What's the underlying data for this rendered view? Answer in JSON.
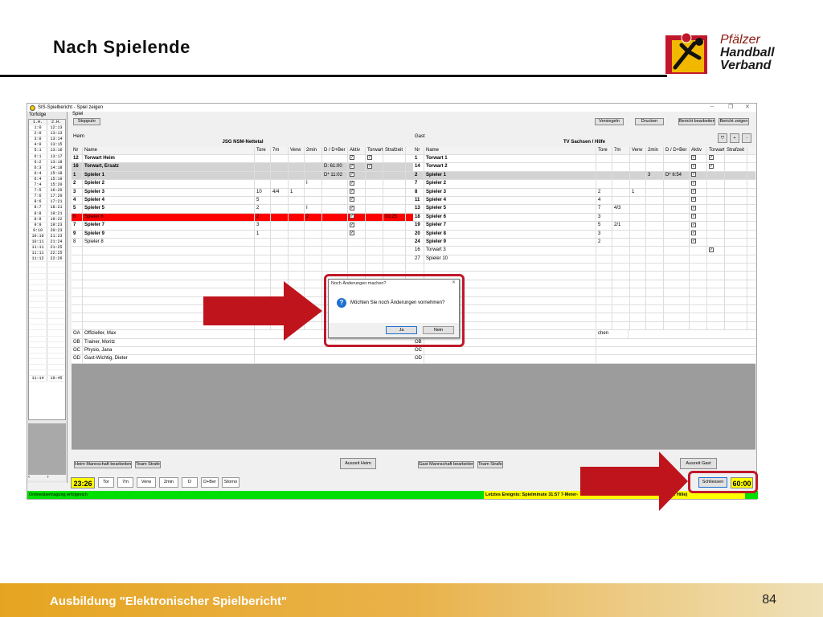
{
  "slide": {
    "title": "Nach Spielende",
    "footer": "Ausbildung \"Elektronischer Spielbericht\"",
    "page_number": "84",
    "logo_line1": "Pfälzer",
    "logo_line2": "Handball",
    "logo_line3": "Verband"
  },
  "app": {
    "window_title": "SIS-Spielbericht - Spiel zeigen",
    "left_panel_title": "Torfolge",
    "ticker_header": [
      "1.H.",
      "2.H."
    ],
    "ticker": [
      [
        "1:0",
        "12:13"
      ],
      [
        "2:0",
        "13:13"
      ],
      [
        "3:0",
        "13:14"
      ],
      [
        "4:0",
        "13:15"
      ],
      [
        "5:1",
        "13:16"
      ],
      [
        "6:1",
        "13:17"
      ],
      [
        "6:2",
        "13:18"
      ],
      [
        "6:3",
        "14:18"
      ],
      [
        "6:4",
        "15:18"
      ],
      [
        "6:4",
        "15:19"
      ],
      [
        "7:4",
        "15:20"
      ],
      [
        "7:5",
        "16:20"
      ],
      [
        "7:6",
        "17:20"
      ],
      [
        "8:6",
        "17:21"
      ],
      [
        "8:7",
        "18:21"
      ],
      [
        "8:8",
        "19:21"
      ],
      [
        "8:9",
        "19:22"
      ],
      [
        "9:9",
        "19:23"
      ],
      [
        "9:10",
        "20:23"
      ],
      [
        "10:10",
        "21:23"
      ],
      [
        "10:11",
        "21:24"
      ],
      [
        "11:11",
        "21:25"
      ],
      [
        "11:11",
        "22:25"
      ],
      [
        "11:12",
        "22:26"
      ]
    ],
    "ticker_last": [
      "11:14",
      "19:45"
    ],
    "section_label": "Spiel",
    "stoppuhr_label": "Stoppuhr",
    "top_buttons": [
      "Versiegeln",
      "Drucken",
      "Bericht bearbeiten",
      "Bericht zeigen"
    ],
    "home": {
      "label": "Heim",
      "team": "JSG NSM-Nettetal",
      "columns": [
        "Nr",
        "Name",
        "Tore",
        "7m",
        "Verw",
        "2min",
        "D / D+Ber",
        "Aktiv",
        "Torwart",
        "Strafzeit"
      ],
      "rows": [
        {
          "nr": "12",
          "name": "Torwart Heim",
          "tore": "",
          "m7": "",
          "verw": "",
          "min2": "",
          "d": "",
          "aktiv": "x",
          "tw": "x",
          "sz": "",
          "style": "bold"
        },
        {
          "nr": "16",
          "name": "Torwart, Ersatz",
          "tore": "",
          "m7": "",
          "verw": "",
          "min2": "",
          "d": "D: 61:00",
          "aktiv": "x",
          "tw": "x",
          "sz": "",
          "style": "bold gray"
        },
        {
          "nr": "1",
          "name": "Spieler 1",
          "tore": "",
          "m7": "",
          "verw": "",
          "min2": "",
          "d": "D* 11:02",
          "aktiv": "x",
          "tw": "",
          "sz": "",
          "style": "bold gray"
        },
        {
          "nr": "2",
          "name": "Spieler 2",
          "tore": "",
          "m7": "",
          "verw": "",
          "min2": "I",
          "d": "",
          "aktiv": "x",
          "tw": "",
          "sz": "",
          "style": "bold"
        },
        {
          "nr": "3",
          "name": "Spieler 3",
          "tore": "10",
          "m7": "4/4",
          "verw": "1",
          "min2": "",
          "d": "",
          "aktiv": "x",
          "tw": "",
          "sz": "",
          "style": "bold"
        },
        {
          "nr": "4",
          "name": "Spieler 4",
          "tore": "5",
          "m7": "",
          "verw": "",
          "min2": "",
          "d": "",
          "aktiv": "x",
          "tw": "",
          "sz": "",
          "style": "bold"
        },
        {
          "nr": "5",
          "name": "Spieler 5",
          "tore": "2",
          "m7": "",
          "verw": "",
          "min2": "I",
          "d": "",
          "aktiv": "x",
          "tw": "",
          "sz": "",
          "style": "bold"
        },
        {
          "nr": "6",
          "name": "Spieler 6",
          "tore": "2",
          "m7": "",
          "verw": "",
          "min2": "2",
          "d": "",
          "aktiv": "x",
          "tw": "",
          "sz": "00:25",
          "style": "red"
        },
        {
          "nr": "7",
          "name": "Spieler 7",
          "tore": "3",
          "m7": "",
          "verw": "",
          "min2": "",
          "d": "",
          "aktiv": "x",
          "tw": "",
          "sz": "",
          "style": "bold"
        },
        {
          "nr": "9",
          "name": "Spieler 9",
          "tore": "1",
          "m7": "",
          "verw": "",
          "min2": "",
          "d": "",
          "aktiv": "x",
          "tw": "",
          "sz": "",
          "style": "bold"
        },
        {
          "nr": "8",
          "name": "Spieler 8",
          "tore": "",
          "m7": "",
          "verw": "",
          "min2": "",
          "d": "",
          "aktiv": "",
          "tw": "",
          "sz": "",
          "style": ""
        }
      ],
      "officials": [
        {
          "nr": "OA",
          "name": "Offizieller, Max"
        },
        {
          "nr": "OB",
          "name": "Trainer, Moritz"
        },
        {
          "nr": "OC",
          "name": "Physio, Jana"
        },
        {
          "nr": "OD",
          "name": "Gast-Wichtig, Dieter"
        }
      ],
      "btn_edit": "Heim Mannschaft bearbeiten",
      "btn_strafe": "Team Strafe",
      "btn_auszeit": "Auszeit Heim"
    },
    "guest": {
      "label": "Gast",
      "team": "TV Sachsen / Hilfe",
      "columns": [
        "Nr",
        "Name",
        "Tore",
        "7m",
        "Verw",
        "2min",
        "D / D+Ber",
        "Aktiv",
        "Torwart",
        "Strafzeit"
      ],
      "rows": [
        {
          "nr": "1",
          "name": "Torwart 1",
          "tore": "",
          "m7": "",
          "verw": "",
          "min2": "",
          "d": "",
          "aktiv": "x",
          "tw": "x",
          "sz": "",
          "style": "bold"
        },
        {
          "nr": "14",
          "name": "Torwart 2",
          "tore": "",
          "m7": "",
          "verw": "",
          "min2": "",
          "d": "",
          "aktiv": "x",
          "tw": "x",
          "sz": "",
          "style": "bold"
        },
        {
          "nr": "2",
          "name": "Spieler 1",
          "tore": "",
          "m7": "",
          "verw": "",
          "min2": "3",
          "d": "D* 6:54",
          "aktiv": "x",
          "tw": "",
          "sz": "",
          "style": "bold gray"
        },
        {
          "nr": "7",
          "name": "Spieler 2",
          "tore": "",
          "m7": "",
          "verw": "",
          "min2": "",
          "d": "",
          "aktiv": "x",
          "tw": "",
          "sz": "",
          "style": "bold"
        },
        {
          "nr": "8",
          "name": "Spieler 3",
          "tore": "2",
          "m7": "",
          "verw": "1",
          "min2": "",
          "d": "",
          "aktiv": "x",
          "tw": "",
          "sz": "",
          "style": "bold"
        },
        {
          "nr": "11",
          "name": "Spieler 4",
          "tore": "4",
          "m7": "",
          "verw": "",
          "min2": "",
          "d": "",
          "aktiv": "x",
          "tw": "",
          "sz": "",
          "style": "bold"
        },
        {
          "nr": "13",
          "name": "Spieler 5",
          "tore": "7",
          "m7": "4/3",
          "verw": "",
          "min2": "",
          "d": "",
          "aktiv": "x",
          "tw": "",
          "sz": "",
          "style": "bold"
        },
        {
          "nr": "18",
          "name": "Spieler 6",
          "tore": "3",
          "m7": "",
          "verw": "",
          "min2": "",
          "d": "",
          "aktiv": "x",
          "tw": "",
          "sz": "",
          "style": "bold"
        },
        {
          "nr": "19",
          "name": "Spieler 7",
          "tore": "5",
          "m7": "2/1",
          "verw": "",
          "min2": "",
          "d": "",
          "aktiv": "x",
          "tw": "",
          "sz": "",
          "style": "bold"
        },
        {
          "nr": "20",
          "name": "Spieler 8",
          "tore": "3",
          "m7": "",
          "verw": "",
          "min2": "",
          "d": "",
          "aktiv": "x",
          "tw": "",
          "sz": "",
          "style": "bold"
        },
        {
          "nr": "24",
          "name": "Spieler 9",
          "tore": "2",
          "m7": "",
          "verw": "",
          "min2": "",
          "d": "",
          "aktiv": "x",
          "tw": "",
          "sz": "",
          "style": "bold"
        },
        {
          "nr": "16",
          "name": "Torwart 3",
          "tore": "",
          "m7": "",
          "verw": "",
          "min2": "",
          "d": "",
          "aktiv": "",
          "tw": "x",
          "sz": "",
          "style": ""
        },
        {
          "nr": "27",
          "name": "Spieler 10",
          "tore": "",
          "m7": "",
          "verw": "",
          "min2": "",
          "d": "",
          "aktiv": "",
          "tw": "",
          "sz": "",
          "style": ""
        }
      ],
      "officials": [
        {
          "nr": "OA",
          "name": "",
          "suffix": "chen"
        },
        {
          "nr": "OB",
          "name": ""
        },
        {
          "nr": "OC",
          "name": ""
        },
        {
          "nr": "OD",
          "name": ""
        }
      ],
      "btn_edit": "Gast Mannschaft bearbeiten",
      "btn_strafe": "Team Strafe",
      "btn_auszeit": "Auszeit Gast"
    },
    "filter_buttons": [
      "+",
      "-"
    ],
    "bottom": {
      "time": "23:26",
      "buttons": [
        "Tor",
        "7m",
        "Verw",
        "2min",
        "D",
        "D+Ber",
        "Storno"
      ],
      "close": "Schliessen",
      "clock": "60:00"
    },
    "status": {
      "left": "Onlineübertragung erfolgreich",
      "right": "Letztes Ereignis: Spielminute 31:57 7-Meter-",
      "right_end": "(6. Hille)"
    },
    "dialog": {
      "title": "Noch Änderungen machen?",
      "message": "Möchten Sie noch Änderungen vornehmen?",
      "yes": "Ja",
      "no": "Nein"
    }
  },
  "colors": {
    "highlight": "#c0182a",
    "arrow": "#c0141c",
    "status_green": "#00e000",
    "clock_yellow": "#ffff00",
    "footer": "#e6a521"
  }
}
